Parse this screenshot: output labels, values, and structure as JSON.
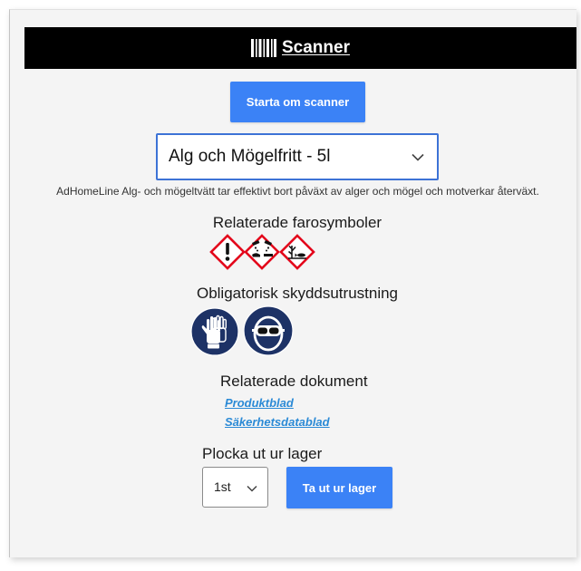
{
  "header": {
    "title": "Scanner",
    "icon": "barcode-icon"
  },
  "restart_button": {
    "label": "Starta om scanner"
  },
  "product_select": {
    "selected": "Alg och Mögelfritt - 5l",
    "icon": "chevron-down-icon"
  },
  "product_description": "AdHomeLine Alg- och mögeltvätt tar effektivt bort påväxt av alger och mögel och motverkar återväxt.",
  "hazards": {
    "heading": "Relaterade farosymboler",
    "symbols": [
      "exclamation-mark-icon",
      "corrosive-icon",
      "environmental-hazard-icon"
    ]
  },
  "protection": {
    "heading": "Obligatorisk skyddsutrustning",
    "items": [
      "protective-gloves-icon",
      "safety-goggles-icon"
    ]
  },
  "documents": {
    "heading": "Relaterade dokument",
    "links": [
      {
        "label": "Produktblad"
      },
      {
        "label": "Säkerhetsdatablad"
      }
    ]
  },
  "stock": {
    "heading": "Plocka ut ur lager",
    "quantity_selected": "1st",
    "button_label": "Ta ut ur lager"
  },
  "colors": {
    "accent": "#3b82f6",
    "header_bg": "#000000",
    "link": "#2b8ad6",
    "hazard_red": "#e3061b",
    "mandatory_blue": "#1d3266",
    "select_border": "#3d73d6"
  }
}
